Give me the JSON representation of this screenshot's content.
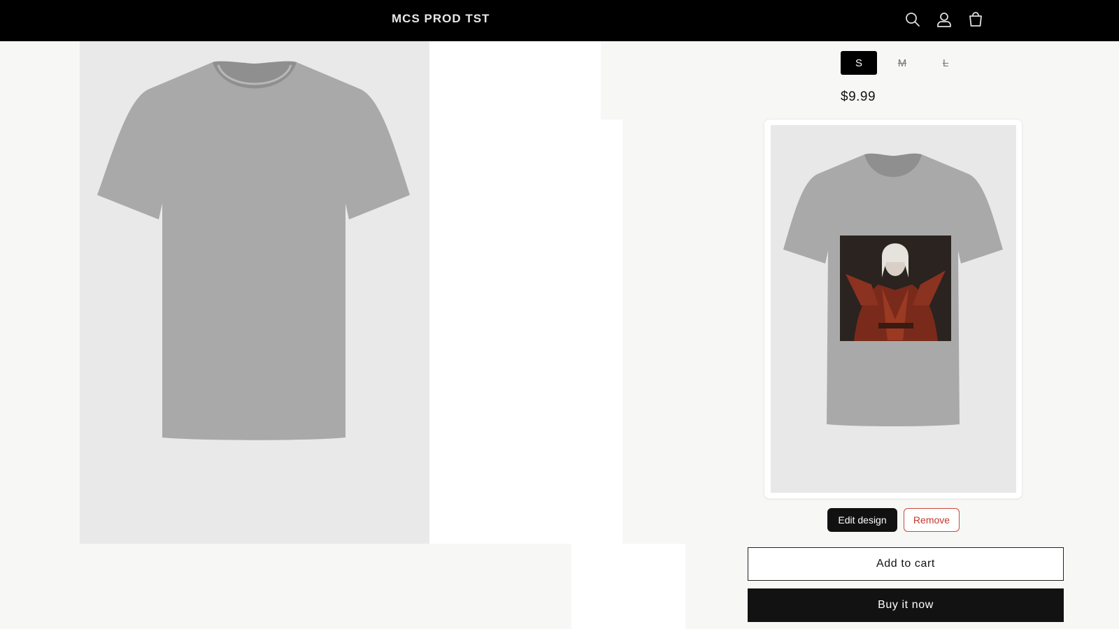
{
  "header": {
    "brand": "MCS PROD TST",
    "icons": [
      "search-icon",
      "account-icon",
      "cart-icon"
    ]
  },
  "product": {
    "sizes": [
      {
        "label": "S",
        "selected": true,
        "available": true
      },
      {
        "label": "M",
        "selected": false,
        "available": false
      },
      {
        "label": "L",
        "selected": false,
        "available": false
      }
    ],
    "price": "$9.99",
    "main_image": "tshirt-grey",
    "design_preview": "tshirt-grey-with-vampire-character-print"
  },
  "design": {
    "edit_label": "Edit design",
    "remove_label": "Remove"
  },
  "actions": {
    "add_to_cart_label": "Add to cart",
    "buy_now_label": "Buy it now"
  },
  "colors": {
    "header_bg": "#000000",
    "primary": "#121212",
    "remove_red": "#c0392b",
    "shirt_grey": "#a8a8a8",
    "image_bg": "#e9e9e9"
  }
}
